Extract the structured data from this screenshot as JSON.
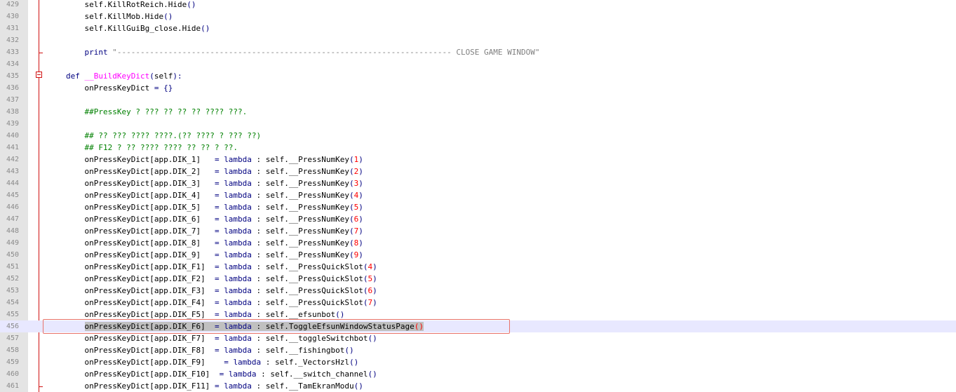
{
  "editor": {
    "highlighted_line": 456,
    "lines": [
      {
        "n": "429",
        "indent": "    ",
        "tokens": [
          {
            "t": "self.KillRotReich.Hide"
          },
          {
            "t": "()",
            "c": "op"
          }
        ]
      },
      {
        "n": "430",
        "indent": "    ",
        "tokens": [
          {
            "t": "self.KillMob.Hide"
          },
          {
            "t": "()",
            "c": "op"
          }
        ]
      },
      {
        "n": "431",
        "indent": "    ",
        "tokens": [
          {
            "t": "self.KillGuiBg_close.Hide"
          },
          {
            "t": "()",
            "c": "op"
          }
        ]
      },
      {
        "n": "432",
        "indent": "",
        "tokens": []
      },
      {
        "n": "433",
        "indent": "    ",
        "tokens": [
          {
            "t": "print",
            "c": "kw"
          },
          {
            "t": " "
          },
          {
            "t": "\"------------------------------------------------------------------------ CLOSE GAME WINDOW\"",
            "c": "str"
          }
        ]
      },
      {
        "n": "434",
        "indent": "",
        "tokens": []
      },
      {
        "n": "435",
        "indent": "",
        "tokens": [
          {
            "t": "def",
            "c": "kw"
          },
          {
            "t": " "
          },
          {
            "t": "__BuildKeyDict",
            "c": "fn"
          },
          {
            "t": "(",
            "c": "op"
          },
          {
            "t": "self"
          },
          {
            "t": "):",
            "c": "op"
          }
        ]
      },
      {
        "n": "436",
        "indent": "    ",
        "tokens": [
          {
            "t": "onPressKeyDict "
          },
          {
            "t": "= {}",
            "c": "op"
          }
        ]
      },
      {
        "n": "437",
        "indent": "",
        "tokens": []
      },
      {
        "n": "438",
        "indent": "    ",
        "tokens": [
          {
            "t": "##PressKey ? ??? ?? ?? ?? ???? ???.",
            "c": "cm"
          }
        ]
      },
      {
        "n": "439",
        "indent": "",
        "tokens": []
      },
      {
        "n": "440",
        "indent": "    ",
        "tokens": [
          {
            "t": "## ?? ??? ???? ????.(?? ???? ? ??? ??)",
            "c": "cm"
          }
        ]
      },
      {
        "n": "441",
        "indent": "    ",
        "tokens": [
          {
            "t": "## F12 ? ?? ???? ???? ?? ?? ? ??.",
            "c": "cm"
          }
        ]
      },
      {
        "n": "442",
        "indent": "    ",
        "tokens": [
          {
            "t": "onPressKeyDict[app.DIK_1]   "
          },
          {
            "t": "=",
            "c": "op"
          },
          {
            "t": " "
          },
          {
            "t": "lambda",
            "c": "kw"
          },
          {
            "t": " : self.__PressNumKey"
          },
          {
            "t": "(",
            "c": "op"
          },
          {
            "t": "1",
            "c": "num"
          },
          {
            "t": ")",
            "c": "op"
          }
        ]
      },
      {
        "n": "443",
        "indent": "    ",
        "tokens": [
          {
            "t": "onPressKeyDict[app.DIK_2]   "
          },
          {
            "t": "=",
            "c": "op"
          },
          {
            "t": " "
          },
          {
            "t": "lambda",
            "c": "kw"
          },
          {
            "t": " : self.__PressNumKey"
          },
          {
            "t": "(",
            "c": "op"
          },
          {
            "t": "2",
            "c": "num"
          },
          {
            "t": ")",
            "c": "op"
          }
        ]
      },
      {
        "n": "444",
        "indent": "    ",
        "tokens": [
          {
            "t": "onPressKeyDict[app.DIK_3]   "
          },
          {
            "t": "=",
            "c": "op"
          },
          {
            "t": " "
          },
          {
            "t": "lambda",
            "c": "kw"
          },
          {
            "t": " : self.__PressNumKey"
          },
          {
            "t": "(",
            "c": "op"
          },
          {
            "t": "3",
            "c": "num"
          },
          {
            "t": ")",
            "c": "op"
          }
        ]
      },
      {
        "n": "445",
        "indent": "    ",
        "tokens": [
          {
            "t": "onPressKeyDict[app.DIK_4]   "
          },
          {
            "t": "=",
            "c": "op"
          },
          {
            "t": " "
          },
          {
            "t": "lambda",
            "c": "kw"
          },
          {
            "t": " : self.__PressNumKey"
          },
          {
            "t": "(",
            "c": "op"
          },
          {
            "t": "4",
            "c": "num"
          },
          {
            "t": ")",
            "c": "op"
          }
        ]
      },
      {
        "n": "446",
        "indent": "    ",
        "tokens": [
          {
            "t": "onPressKeyDict[app.DIK_5]   "
          },
          {
            "t": "=",
            "c": "op"
          },
          {
            "t": " "
          },
          {
            "t": "lambda",
            "c": "kw"
          },
          {
            "t": " : self.__PressNumKey"
          },
          {
            "t": "(",
            "c": "op"
          },
          {
            "t": "5",
            "c": "num"
          },
          {
            "t": ")",
            "c": "op"
          }
        ]
      },
      {
        "n": "447",
        "indent": "    ",
        "tokens": [
          {
            "t": "onPressKeyDict[app.DIK_6]   "
          },
          {
            "t": "=",
            "c": "op"
          },
          {
            "t": " "
          },
          {
            "t": "lambda",
            "c": "kw"
          },
          {
            "t": " : self.__PressNumKey"
          },
          {
            "t": "(",
            "c": "op"
          },
          {
            "t": "6",
            "c": "num"
          },
          {
            "t": ")",
            "c": "op"
          }
        ]
      },
      {
        "n": "448",
        "indent": "    ",
        "tokens": [
          {
            "t": "onPressKeyDict[app.DIK_7]   "
          },
          {
            "t": "=",
            "c": "op"
          },
          {
            "t": " "
          },
          {
            "t": "lambda",
            "c": "kw"
          },
          {
            "t": " : self.__PressNumKey"
          },
          {
            "t": "(",
            "c": "op"
          },
          {
            "t": "7",
            "c": "num"
          },
          {
            "t": ")",
            "c": "op"
          }
        ]
      },
      {
        "n": "449",
        "indent": "    ",
        "tokens": [
          {
            "t": "onPressKeyDict[app.DIK_8]   "
          },
          {
            "t": "=",
            "c": "op"
          },
          {
            "t": " "
          },
          {
            "t": "lambda",
            "c": "kw"
          },
          {
            "t": " : self.__PressNumKey"
          },
          {
            "t": "(",
            "c": "op"
          },
          {
            "t": "8",
            "c": "num"
          },
          {
            "t": ")",
            "c": "op"
          }
        ]
      },
      {
        "n": "450",
        "indent": "    ",
        "tokens": [
          {
            "t": "onPressKeyDict[app.DIK_9]   "
          },
          {
            "t": "=",
            "c": "op"
          },
          {
            "t": " "
          },
          {
            "t": "lambda",
            "c": "kw"
          },
          {
            "t": " : self.__PressNumKey"
          },
          {
            "t": "(",
            "c": "op"
          },
          {
            "t": "9",
            "c": "num"
          },
          {
            "t": ")",
            "c": "op"
          }
        ]
      },
      {
        "n": "451",
        "indent": "    ",
        "tokens": [
          {
            "t": "onPressKeyDict[app.DIK_F1]  "
          },
          {
            "t": "=",
            "c": "op"
          },
          {
            "t": " "
          },
          {
            "t": "lambda",
            "c": "kw"
          },
          {
            "t": " : self.__PressQuickSlot"
          },
          {
            "t": "(",
            "c": "op"
          },
          {
            "t": "4",
            "c": "num"
          },
          {
            "t": ")",
            "c": "op"
          }
        ]
      },
      {
        "n": "452",
        "indent": "    ",
        "tokens": [
          {
            "t": "onPressKeyDict[app.DIK_F2]  "
          },
          {
            "t": "=",
            "c": "op"
          },
          {
            "t": " "
          },
          {
            "t": "lambda",
            "c": "kw"
          },
          {
            "t": " : self.__PressQuickSlot"
          },
          {
            "t": "(",
            "c": "op"
          },
          {
            "t": "5",
            "c": "num"
          },
          {
            "t": ")",
            "c": "op"
          }
        ]
      },
      {
        "n": "453",
        "indent": "    ",
        "tokens": [
          {
            "t": "onPressKeyDict[app.DIK_F3]  "
          },
          {
            "t": "=",
            "c": "op"
          },
          {
            "t": " "
          },
          {
            "t": "lambda",
            "c": "kw"
          },
          {
            "t": " : self.__PressQuickSlot"
          },
          {
            "t": "(",
            "c": "op"
          },
          {
            "t": "6",
            "c": "num"
          },
          {
            "t": ")",
            "c": "op"
          }
        ]
      },
      {
        "n": "454",
        "indent": "    ",
        "tokens": [
          {
            "t": "onPressKeyDict[app.DIK_F4]  "
          },
          {
            "t": "=",
            "c": "op"
          },
          {
            "t": " "
          },
          {
            "t": "lambda",
            "c": "kw"
          },
          {
            "t": " : self.__PressQuickSlot"
          },
          {
            "t": "(",
            "c": "op"
          },
          {
            "t": "7",
            "c": "num"
          },
          {
            "t": ")",
            "c": "op"
          }
        ]
      },
      {
        "n": "455",
        "indent": "    ",
        "tokens": [
          {
            "t": "onPressKeyDict[app.DIK_F5]  "
          },
          {
            "t": "=",
            "c": "op"
          },
          {
            "t": " "
          },
          {
            "t": "lambda",
            "c": "kw"
          },
          {
            "t": " : self.__efsunbot"
          },
          {
            "t": "()",
            "c": "op"
          }
        ]
      },
      {
        "n": "456",
        "indent": "    ",
        "tokens": [
          {
            "t": "onPressKeyDict[app.DIK_F6]  ",
            "sel": true
          },
          {
            "t": "=",
            "c": "op",
            "sel": true
          },
          {
            "t": " ",
            "sel": true
          },
          {
            "t": "lambda",
            "c": "kw",
            "sel": true
          },
          {
            "t": " : self.ToggleEfsunWindowStatusPage",
            "sel": true
          },
          {
            "t": "(",
            "c": "num",
            "sel": true
          },
          {
            "t": ")",
            "c": "num",
            "sel": true
          }
        ]
      },
      {
        "n": "457",
        "indent": "    ",
        "tokens": [
          {
            "t": "onPressKeyDict[app.DIK_F7]  "
          },
          {
            "t": "=",
            "c": "op"
          },
          {
            "t": " "
          },
          {
            "t": "lambda",
            "c": "kw"
          },
          {
            "t": " : self.__toggleSwitchbot"
          },
          {
            "t": "()",
            "c": "op"
          }
        ]
      },
      {
        "n": "458",
        "indent": "    ",
        "tokens": [
          {
            "t": "onPressKeyDict[app.DIK_F8]  "
          },
          {
            "t": "=",
            "c": "op"
          },
          {
            "t": " "
          },
          {
            "t": "lambda",
            "c": "kw"
          },
          {
            "t": " : self.__fishingbot"
          },
          {
            "t": "()",
            "c": "op"
          }
        ]
      },
      {
        "n": "459",
        "indent": "    ",
        "tokens": [
          {
            "t": "onPressKeyDict[app.DIK_F9]    "
          },
          {
            "t": "=",
            "c": "op"
          },
          {
            "t": " "
          },
          {
            "t": "lambda",
            "c": "kw"
          },
          {
            "t": " : self._VectorsHzl"
          },
          {
            "t": "()",
            "c": "op"
          }
        ]
      },
      {
        "n": "460",
        "indent": "    ",
        "tokens": [
          {
            "t": "onPressKeyDict[app.DIK_F10]  "
          },
          {
            "t": "=",
            "c": "op"
          },
          {
            "t": " "
          },
          {
            "t": "lambda",
            "c": "kw"
          },
          {
            "t": " : self.__switch_channel"
          },
          {
            "t": "()",
            "c": "op"
          }
        ]
      },
      {
        "n": "461",
        "indent": "    ",
        "tokens": [
          {
            "t": "onPressKeyDict[app.DIK_F11] "
          },
          {
            "t": "=",
            "c": "op"
          },
          {
            "t": " "
          },
          {
            "t": "lambda",
            "c": "kw"
          },
          {
            "t": " : self.__TamEkranModu"
          },
          {
            "t": "()",
            "c": "op"
          }
        ]
      }
    ]
  }
}
